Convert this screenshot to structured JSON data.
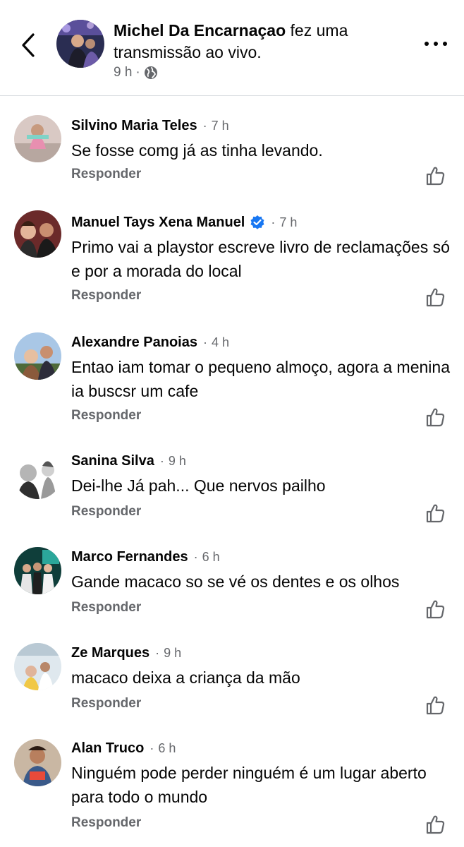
{
  "post": {
    "author": "Michel Da Encarnaçao",
    "action": "fez uma transmissão ao vivo.",
    "time": "9 h",
    "separator": "·",
    "privacy_icon": "globe-icon"
  },
  "colors": {
    "text": "#050505",
    "secondary": "#65676b",
    "verified": "#1877f2",
    "divider": "#dadde1"
  },
  "comments": [
    {
      "name": "Silvino Maria Teles",
      "verified": false,
      "time": "7 h",
      "text": "Se fosse comg já as tinha levando.",
      "reply": "Responder"
    },
    {
      "name": "Manuel Tays Xena Manuel",
      "verified": true,
      "time": "7 h",
      "text": "Primo  vai a playstor escreve livro de reclamações só e por a morada do local",
      "reply": "Responder"
    },
    {
      "name": "Alexandre Panoias",
      "verified": false,
      "time": "4 h",
      "text": "Entao iam tomar o pequeno almoço,  agora a menina ia buscsr um cafe",
      "reply": "Responder"
    },
    {
      "name": "Sanina Silva",
      "verified": false,
      "time": "9 h",
      "text": "Dei-lhe Já pah... Que nervos pailho",
      "reply": "Responder"
    },
    {
      "name": "Marco Fernandes",
      "verified": false,
      "time": "6 h",
      "text": "Gande macaco so se vé os dentes e os olhos",
      "reply": "Responder"
    },
    {
      "name": "Ze Marques",
      "verified": false,
      "time": "9 h",
      "text": "macaco deixa a criança da mão",
      "reply": "Responder"
    },
    {
      "name": "Alan Truco",
      "verified": false,
      "time": "6 h",
      "text": "Ninguém pode perder ninguém é um lugar aberto para todo o mundo",
      "reply": "Responder"
    }
  ]
}
